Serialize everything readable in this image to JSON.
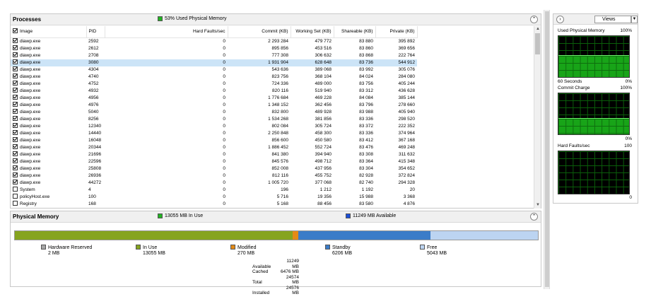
{
  "processes": {
    "title": "Processes",
    "status": "53% Used Physical Memory",
    "status_color": "#22b322",
    "columns": [
      "Image",
      "PID",
      "Hard Faults/sec",
      "Commit (KB)",
      "Working Set (KB)",
      "Shareable (KB)",
      "Private (KB)"
    ],
    "rows": [
      {
        "checked": true,
        "image": "diawp.exe",
        "pid": "2592",
        "faults": "0",
        "commit": "2 293 284",
        "ws": "479 772",
        "share": "83 880",
        "priv": "395 892"
      },
      {
        "checked": true,
        "image": "diawp.exe",
        "pid": "2612",
        "faults": "0",
        "commit": "895 856",
        "ws": "453 516",
        "share": "83 860",
        "priv": "369 656"
      },
      {
        "checked": true,
        "image": "diawp.exe",
        "pid": "2708",
        "faults": "0",
        "commit": "777 308",
        "ws": "306 632",
        "share": "83 868",
        "priv": "222 764"
      },
      {
        "checked": true,
        "image": "diawp.exe",
        "pid": "3080",
        "faults": "0",
        "commit": "1 931 904",
        "ws": "628 648",
        "share": "83 736",
        "priv": "544 912",
        "selected": true
      },
      {
        "checked": true,
        "image": "diawp.exe",
        "pid": "4304",
        "faults": "0",
        "commit": "543 636",
        "ws": "389 068",
        "share": "83 992",
        "priv": "305 076"
      },
      {
        "checked": true,
        "image": "diawp.exe",
        "pid": "4740",
        "faults": "0",
        "commit": "823 756",
        "ws": "368 104",
        "share": "84 024",
        "priv": "284 080"
      },
      {
        "checked": true,
        "image": "diawp.exe",
        "pid": "4752",
        "faults": "0",
        "commit": "724 336",
        "ws": "489 000",
        "share": "83 756",
        "priv": "405 244"
      },
      {
        "checked": true,
        "image": "diawp.exe",
        "pid": "4932",
        "faults": "0",
        "commit": "820 116",
        "ws": "519 940",
        "share": "83 312",
        "priv": "436 628"
      },
      {
        "checked": true,
        "image": "diawp.exe",
        "pid": "4956",
        "faults": "0",
        "commit": "1 776 684",
        "ws": "469 228",
        "share": "84 084",
        "priv": "385 144"
      },
      {
        "checked": true,
        "image": "diawp.exe",
        "pid": "4976",
        "faults": "0",
        "commit": "1 348 152",
        "ws": "362 456",
        "share": "83 796",
        "priv": "278 660"
      },
      {
        "checked": true,
        "image": "diawp.exe",
        "pid": "5040",
        "faults": "0",
        "commit": "832 800",
        "ws": "489 928",
        "share": "83 988",
        "priv": "405 940"
      },
      {
        "checked": true,
        "image": "diawp.exe",
        "pid": "8256",
        "faults": "0",
        "commit": "1 534 268",
        "ws": "381 856",
        "share": "83 336",
        "priv": "298 520"
      },
      {
        "checked": true,
        "image": "diawp.exe",
        "pid": "12340",
        "faults": "0",
        "commit": "802 084",
        "ws": "305 724",
        "share": "83 372",
        "priv": "222 352"
      },
      {
        "checked": true,
        "image": "diawp.exe",
        "pid": "14440",
        "faults": "0",
        "commit": "2 250 848",
        "ws": "458 300",
        "share": "83 336",
        "priv": "374 964"
      },
      {
        "checked": true,
        "image": "diawp.exe",
        "pid": "16048",
        "faults": "0",
        "commit": "856 600",
        "ws": "450 580",
        "share": "83 412",
        "priv": "367 168"
      },
      {
        "checked": true,
        "image": "diawp.exe",
        "pid": "20344",
        "faults": "0",
        "commit": "1 886 452",
        "ws": "552 724",
        "share": "83 476",
        "priv": "469 248"
      },
      {
        "checked": true,
        "image": "diawp.exe",
        "pid": "21696",
        "faults": "0",
        "commit": "841 380",
        "ws": "394 940",
        "share": "83 308",
        "priv": "311 632"
      },
      {
        "checked": true,
        "image": "diawp.exe",
        "pid": "22596",
        "faults": "0",
        "commit": "845 576",
        "ws": "498 712",
        "share": "83 364",
        "priv": "415 348"
      },
      {
        "checked": true,
        "image": "diawp.exe",
        "pid": "25808",
        "faults": "0",
        "commit": "852 008",
        "ws": "437 956",
        "share": "83 304",
        "priv": "354 652"
      },
      {
        "checked": true,
        "image": "diawp.exe",
        "pid": "26936",
        "faults": "0",
        "commit": "812 116",
        "ws": "455 752",
        "share": "82 928",
        "priv": "372 824"
      },
      {
        "checked": true,
        "image": "diawp.exe",
        "pid": "44272",
        "faults": "0",
        "commit": "1 005 720",
        "ws": "377 068",
        "share": "82 740",
        "priv": "294 328"
      },
      {
        "checked": false,
        "image": "System",
        "pid": "4",
        "faults": "0",
        "commit": "196",
        "ws": "1 212",
        "share": "1 192",
        "priv": "20"
      },
      {
        "checked": false,
        "image": "policyHost.exe",
        "pid": "100",
        "faults": "0",
        "commit": "5 716",
        "ws": "19 356",
        "share": "15 988",
        "priv": "3 368"
      },
      {
        "checked": false,
        "image": "Registry",
        "pid": "168",
        "faults": "0",
        "commit": "5 168",
        "ws": "88 456",
        "share": "83 580",
        "priv": "4 876"
      }
    ]
  },
  "memory": {
    "title": "Physical Memory",
    "in_use_status": "13055 MB In Use",
    "available_status": "11249 MB Available",
    "in_use_color": "#22b322",
    "available_color": "#1c4fd8",
    "bar": [
      {
        "label": "Hardware Reserved",
        "value": "2 MB",
        "color": "#a6a6a6",
        "fraction": 0.0001
      },
      {
        "label": "In Use",
        "value": "13055 MB",
        "color": "#86a41f",
        "fraction": 0.5313
      },
      {
        "label": "Modified",
        "value": "270 MB",
        "color": "#e48a16",
        "fraction": 0.011
      },
      {
        "label": "Standby",
        "value": "6206 MB",
        "color": "#3b7cc8",
        "fraction": 0.2525
      },
      {
        "label": "Free",
        "value": "5043 MB",
        "color": "#bcd4f1",
        "fraction": 0.2052
      }
    ],
    "summary": [
      {
        "label": "Available",
        "value": "11249 MB"
      },
      {
        "label": "Cached",
        "value": "6476 MB"
      },
      {
        "label": "Total",
        "value": "24574 MB"
      },
      {
        "label": "Installed",
        "value": "24576 MB"
      }
    ]
  },
  "side": {
    "views_label": "Views",
    "graphs": [
      {
        "title": "Used Physical Memory",
        "max": "100%",
        "sub": "60 Seconds",
        "min": "0%",
        "level": 0.53
      },
      {
        "title": "Commit Charge",
        "max": "100%",
        "sub": "",
        "min": "0%",
        "level": 0.4
      },
      {
        "title": "Hard Faults/sec",
        "max": "100",
        "sub": "",
        "min": "0",
        "level": 0.0
      }
    ]
  }
}
